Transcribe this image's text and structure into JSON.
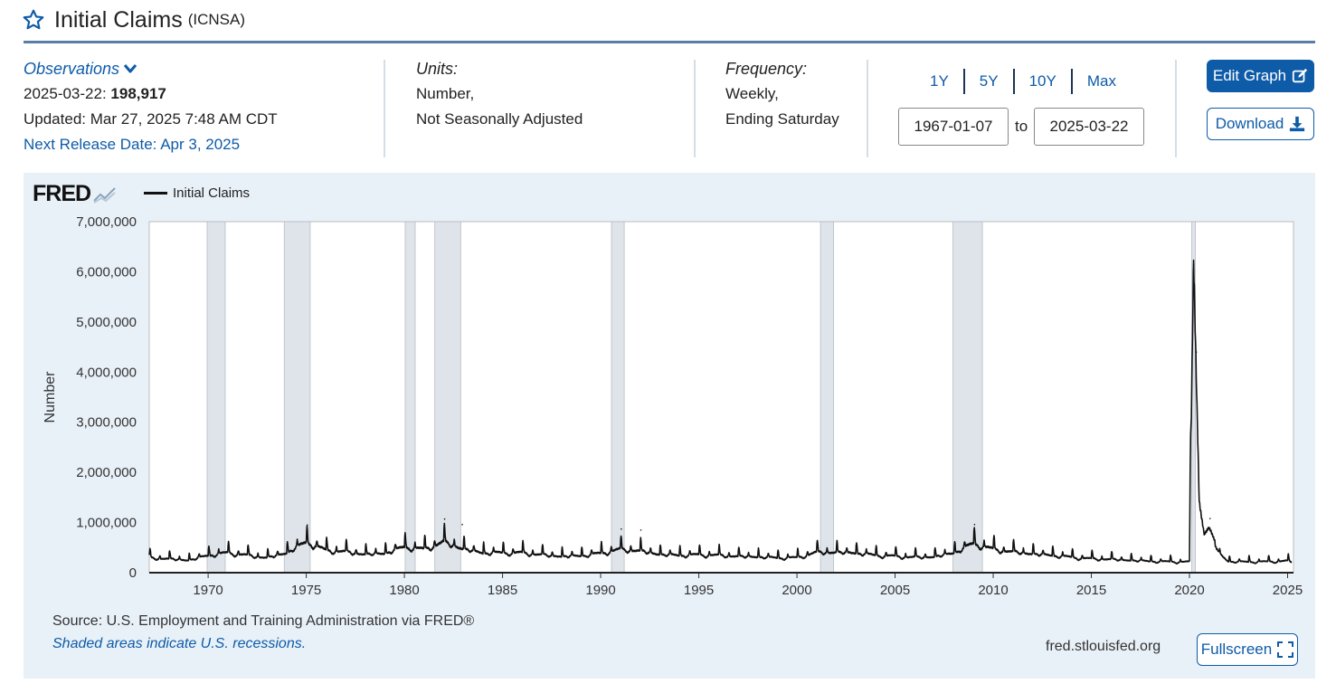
{
  "header": {
    "title": "Initial Claims",
    "code": "(ICNSA)"
  },
  "observations": {
    "heading": "Observations",
    "date_label": "2025-03-22:",
    "value": "198,917",
    "updated": "Updated: Mar 27, 2025 7:48 AM CDT",
    "next_release": "Next Release Date: Apr 3, 2025"
  },
  "units": {
    "heading": "Units:",
    "line1": "Number,",
    "line2": "Not Seasonally Adjusted"
  },
  "frequency": {
    "heading": "Frequency:",
    "line1": "Weekly,",
    "line2": "Ending Saturday"
  },
  "ranges": [
    "1Y",
    "5Y",
    "10Y",
    "Max"
  ],
  "date_range": {
    "from": "1967-01-07",
    "to_label": "to",
    "to": "2025-03-22"
  },
  "buttons": {
    "edit": "Edit Graph",
    "download": "Download",
    "fullscreen": "Fullscreen"
  },
  "footer": {
    "source": "Source: U.S. Employment and Training Administration via FRED®",
    "recession_note": "Shaded areas indicate U.S. recessions.",
    "site": "fred.stlouisfed.org"
  },
  "logo_text": "FRED",
  "colors": {
    "accent": "#0e5ba8",
    "panel_bg": "#e9f1f8",
    "recession": "#dfe4ea",
    "line": "#111111"
  },
  "chart_data": {
    "type": "line",
    "title": "",
    "xlabel": "",
    "ylabel": "Number",
    "xlim": [
      1967.0,
      2025.3
    ],
    "ylim": [
      0,
      7000000
    ],
    "yticks": [
      0,
      1000000,
      2000000,
      3000000,
      4000000,
      5000000,
      6000000,
      7000000
    ],
    "ytick_labels": [
      "0",
      "1,000,000",
      "2,000,000",
      "3,000,000",
      "4,000,000",
      "5,000,000",
      "6,000,000",
      "7,000,000"
    ],
    "xticks": [
      1970,
      1975,
      1980,
      1985,
      1990,
      1995,
      2000,
      2005,
      2010,
      2015,
      2020,
      2025
    ],
    "xtick_labels": [
      "1970",
      "1975",
      "1980",
      "1985",
      "1990",
      "1995",
      "2000",
      "2005",
      "2010",
      "2015",
      "2020",
      "2025"
    ],
    "legend": "top-left",
    "grid": false,
    "recessions": [
      [
        1969.95,
        1970.87
      ],
      [
        1973.88,
        1975.2
      ],
      [
        1980.04,
        1980.55
      ],
      [
        1981.55,
        1982.87
      ],
      [
        1990.55,
        1991.2
      ],
      [
        2001.2,
        2001.87
      ],
      [
        2007.95,
        2009.45
      ],
      [
        2020.12,
        2020.3
      ]
    ],
    "series": [
      {
        "name": "Initial Claims",
        "peak_annotations": [
          {
            "x": 1975.05,
            "y": 950000
          },
          {
            "x": 1982.05,
            "y": 1070000
          },
          {
            "x": 1982.95,
            "y": 960000
          },
          {
            "x": 1991.05,
            "y": 870000
          },
          {
            "x": 1992.05,
            "y": 850000
          },
          {
            "x": 2009.05,
            "y": 960000
          },
          {
            "x": 2020.22,
            "y": 6150000
          },
          {
            "x": 2020.35,
            "y": 4400000
          },
          {
            "x": 2021.05,
            "y": 1080000
          }
        ],
        "points": [
          [
            1967.0,
            300000
          ],
          [
            1968.0,
            280000
          ],
          [
            1969.0,
            250000
          ],
          [
            1970.0,
            350000
          ],
          [
            1971.0,
            400000
          ],
          [
            1972.0,
            350000
          ],
          [
            1973.0,
            300000
          ],
          [
            1974.0,
            400000
          ],
          [
            1975.0,
            620000
          ],
          [
            1976.0,
            450000
          ],
          [
            1977.0,
            420000
          ],
          [
            1978.0,
            370000
          ],
          [
            1979.0,
            390000
          ],
          [
            1980.0,
            520000
          ],
          [
            1981.0,
            470000
          ],
          [
            1982.0,
            620000
          ],
          [
            1983.0,
            480000
          ],
          [
            1984.0,
            400000
          ],
          [
            1985.0,
            400000
          ],
          [
            1986.0,
            400000
          ],
          [
            1987.0,
            360000
          ],
          [
            1988.0,
            330000
          ],
          [
            1989.0,
            340000
          ],
          [
            1990.0,
            390000
          ],
          [
            1991.0,
            470000
          ],
          [
            1992.0,
            440000
          ],
          [
            1993.0,
            370000
          ],
          [
            1994.0,
            350000
          ],
          [
            1995.0,
            360000
          ],
          [
            1996.0,
            350000
          ],
          [
            1997.0,
            330000
          ],
          [
            1998.0,
            320000
          ],
          [
            1999.0,
            300000
          ],
          [
            2000.0,
            300000
          ],
          [
            2001.0,
            410000
          ],
          [
            2002.0,
            410000
          ],
          [
            2003.0,
            400000
          ],
          [
            2004.0,
            350000
          ],
          [
            2005.0,
            330000
          ],
          [
            2006.0,
            310000
          ],
          [
            2007.0,
            320000
          ],
          [
            2008.0,
            400000
          ],
          [
            2009.0,
            590000
          ],
          [
            2010.0,
            470000
          ],
          [
            2011.0,
            420000
          ],
          [
            2012.0,
            380000
          ],
          [
            2013.0,
            350000
          ],
          [
            2014.0,
            310000
          ],
          [
            2015.0,
            280000
          ],
          [
            2016.0,
            270000
          ],
          [
            2017.0,
            250000
          ],
          [
            2018.0,
            230000
          ],
          [
            2019.0,
            220000
          ],
          [
            2020.0,
            220000
          ],
          [
            2020.21,
            6150000
          ],
          [
            2020.5,
            1450000
          ],
          [
            2020.75,
            800000
          ],
          [
            2021.0,
            900000
          ],
          [
            2021.5,
            400000
          ],
          [
            2022.0,
            220000
          ],
          [
            2023.0,
            220000
          ],
          [
            2024.0,
            220000
          ],
          [
            2025.0,
            240000
          ],
          [
            2025.22,
            198917
          ]
        ]
      }
    ]
  }
}
